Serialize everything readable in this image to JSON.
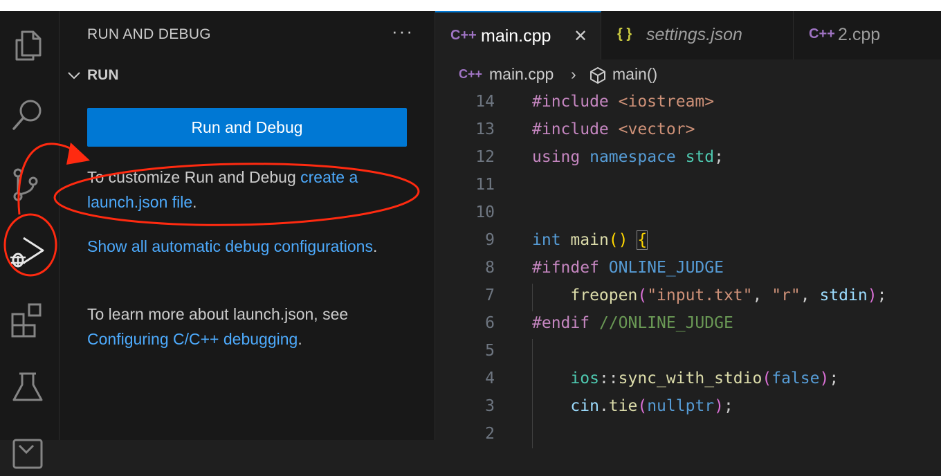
{
  "sidebar": {
    "title": "RUN AND DEBUG",
    "more": "···",
    "section": "RUN",
    "run_button": "Run and Debug",
    "p1_text": "To customize Run and Debug ",
    "p1_link": "create a launch.json file",
    "p1_end": ".",
    "p2_link": "Show all automatic debug configurations",
    "p2_end": ".",
    "p3_text": "To learn more about launch.json, see ",
    "p3_link": "Configuring C/C++ debugging",
    "p3_end": "."
  },
  "activity_bar": {
    "icons": [
      "explorer-icon",
      "search-icon",
      "source-control-icon",
      "run-debug-icon",
      "extensions-icon",
      "testing-icon",
      "remote-icon"
    ]
  },
  "tabs": [
    {
      "icon": "C++",
      "name": "main.cpp",
      "close": "✕",
      "active": true
    },
    {
      "icon": "{ }",
      "name": "settings.json",
      "active": false
    },
    {
      "icon": "C++",
      "name": "2.cpp",
      "active": false
    }
  ],
  "breadcrumb": {
    "file_icon": "C++",
    "file": "main.cpp",
    "sep": "›",
    "symbol": "main()"
  },
  "code": {
    "line_numbers": [
      "14",
      "13",
      "12",
      "11",
      "10",
      "9",
      "8",
      "7",
      "6",
      "5",
      "4",
      "3",
      "2"
    ]
  },
  "colors": {
    "accent": "#0078d4",
    "link": "#4daafc",
    "annotation": "#ff2a10"
  }
}
